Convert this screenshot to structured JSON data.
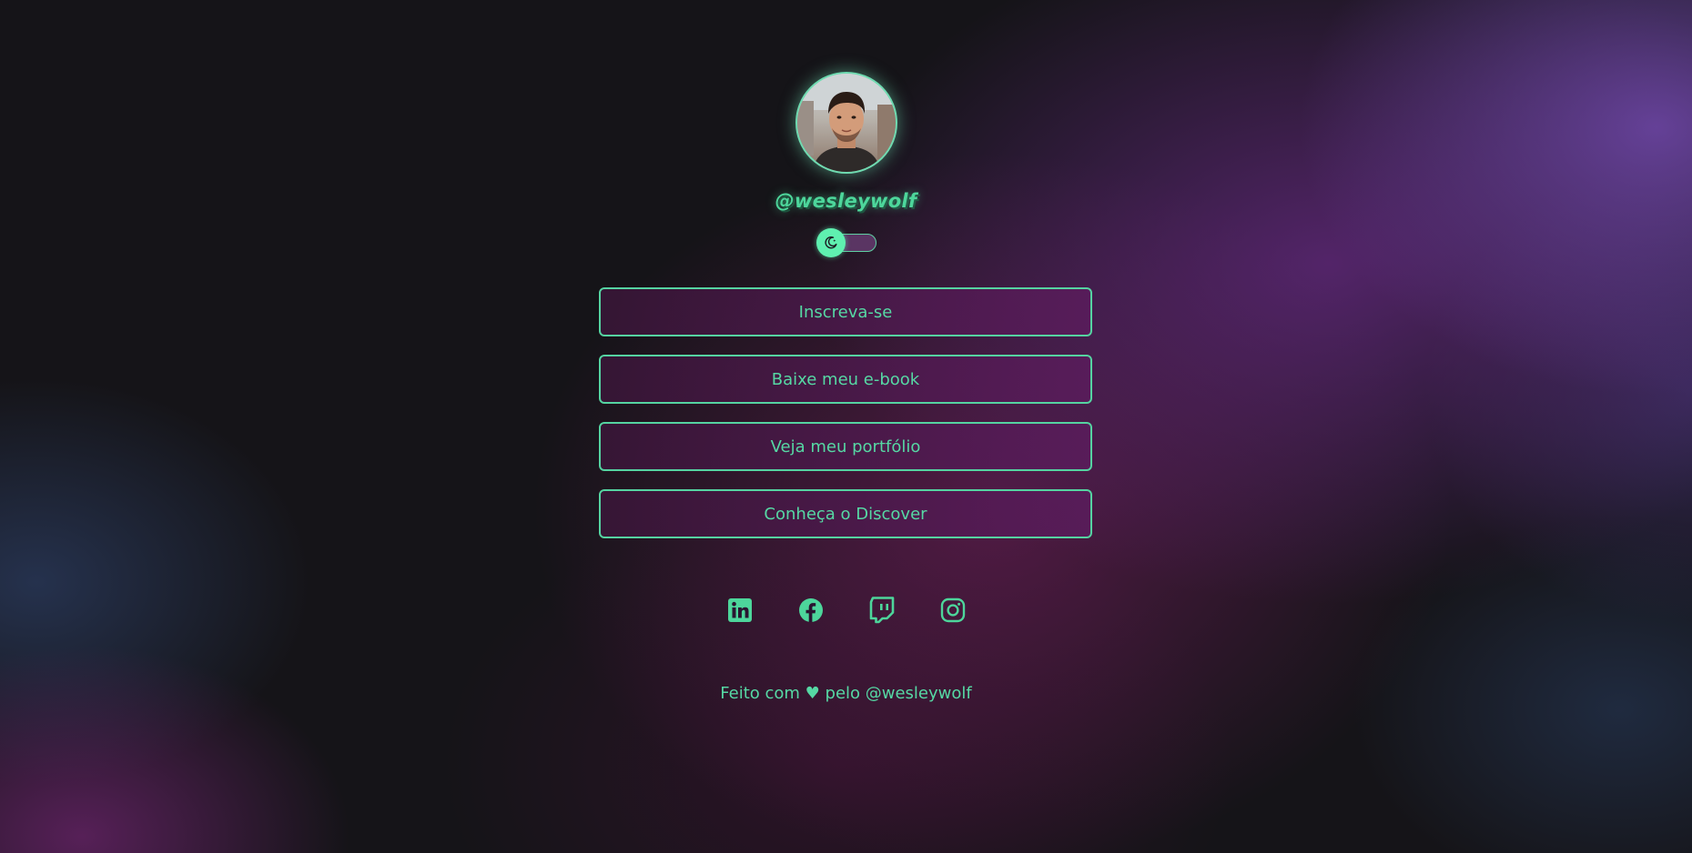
{
  "profile": {
    "username": "@wesleywolf",
    "avatar_alt": "profile photo"
  },
  "theme_toggle": {
    "icon": "moon-icon",
    "state": "dark"
  },
  "links": [
    {
      "label": "Inscreva-se"
    },
    {
      "label": "Baixe meu e-book"
    },
    {
      "label": "Veja meu portfólio"
    },
    {
      "label": "Conheça o Discover"
    }
  ],
  "social": [
    {
      "icon": "linkedin-icon"
    },
    {
      "icon": "facebook-icon"
    },
    {
      "icon": "twitch-icon"
    },
    {
      "icon": "instagram-icon"
    }
  ],
  "footer": {
    "text": "Feito com ♥ pelo @wesleywolf"
  },
  "colors": {
    "accent": "#56d8a4",
    "button_bg": "#5a1c5c",
    "background_dark": "#151418",
    "background_purple": "#7048aa"
  }
}
